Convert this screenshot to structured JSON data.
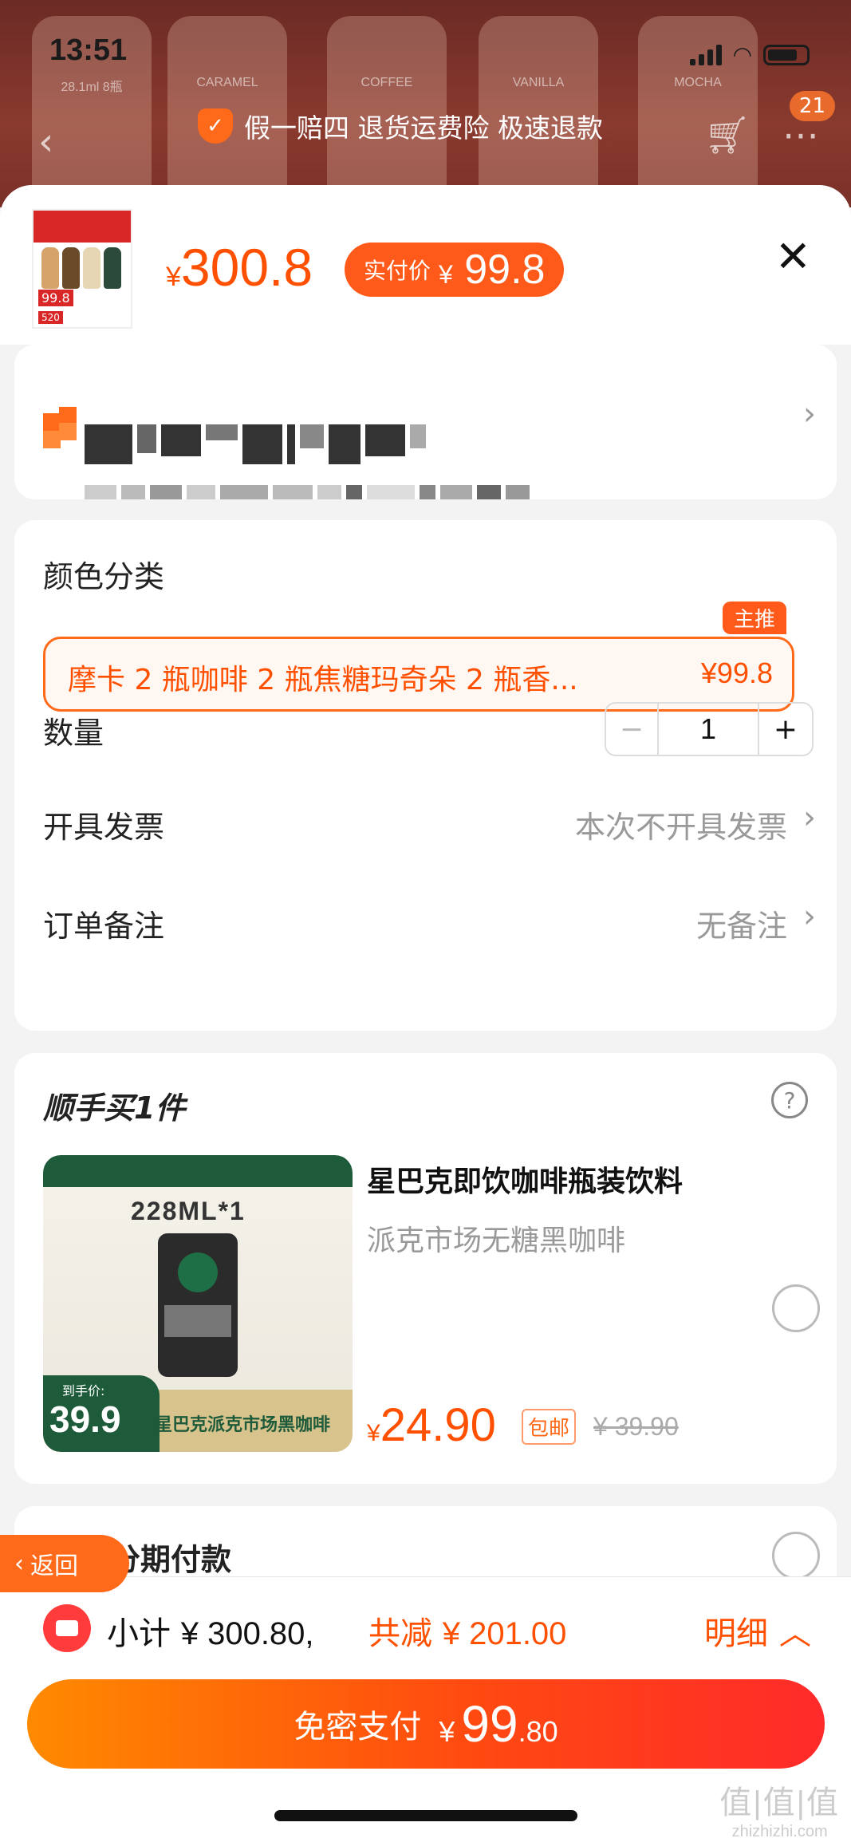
{
  "status": {
    "time": "13:51"
  },
  "bg": {
    "bottles": [
      "28.1ml\n8瓶",
      "CARAMEL",
      "COFFEE",
      "VANILLA",
      "MOCHA"
    ],
    "cart_badge": "21",
    "guarantee_text": "假一赔四 退货运费险 极速退款"
  },
  "header": {
    "price_yen": "¥",
    "price": "300.8",
    "real_label": "实付价",
    "real_yen": "¥",
    "real_int": "99",
    "real_dec": ".8",
    "close": "✕"
  },
  "address": {
    "chevron": "›"
  },
  "options": {
    "color_label": "颜色分类",
    "variant_tag": "主推",
    "variant_text": "摩卡 2 瓶咖啡 2 瓶焦糖玛奇朵 2 瓶香...",
    "variant_price": "¥99.8",
    "qty_label": "数量",
    "qty_minus": "−",
    "qty_value": "1",
    "qty_plus": "+",
    "invoice_label": "开具发票",
    "invoice_value": "本次不开具发票",
    "note_label": "订单备注",
    "note_value": "无备注"
  },
  "addon": {
    "title": "顺手买1件",
    "help": "?",
    "img_ml": "228ML*1",
    "img_price_label": "到手价:",
    "img_price": "39.9",
    "img_caption": "星巴克派克市场黑咖啡",
    "name": "星巴克即饮咖啡瓶装饮料",
    "sub": "派克市场无糖黑咖啡",
    "price_yen": "¥",
    "price": "24.90",
    "ship": "包邮",
    "orig": "¥ 39.90"
  },
  "install": {
    "label": "分期付款"
  },
  "back": {
    "label": "返回"
  },
  "footer": {
    "subtotal_label": "小计",
    "subtotal_value": "¥ 300.80,",
    "discount_label": "共减",
    "discount_value": "¥ 201.00",
    "detail_label": "明细",
    "pay_label": "免密支付",
    "pay_yen": "¥",
    "pay_int": "99",
    "pay_dec": ".80"
  },
  "watermark": {
    "line1": "值|值|值",
    "line2": "zhizhizhi.com"
  }
}
